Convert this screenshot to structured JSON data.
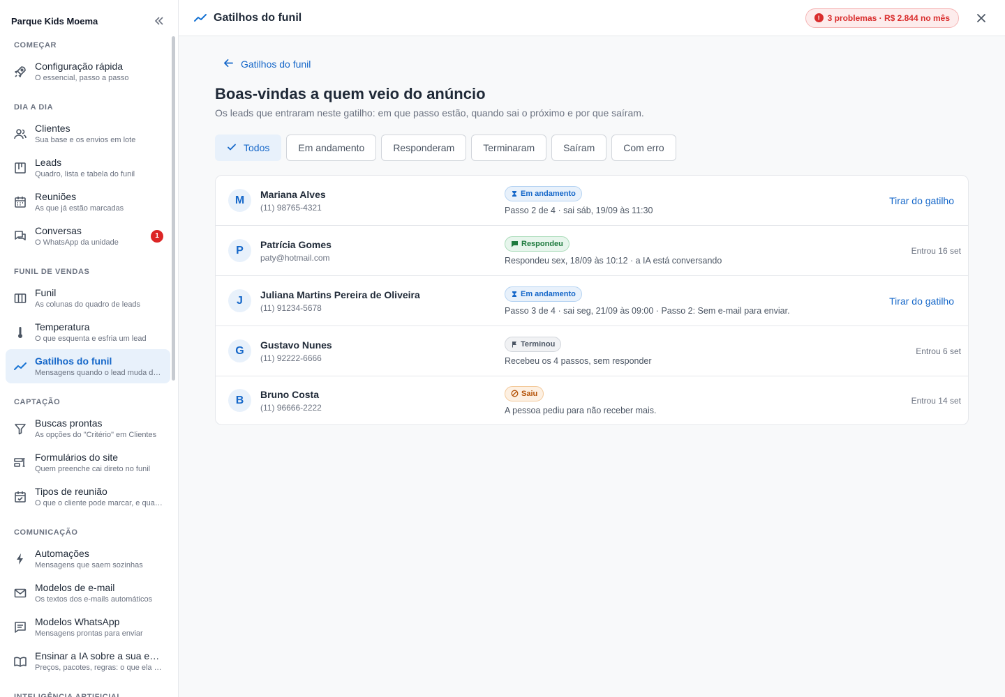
{
  "sidebar": {
    "org_name": "Parque Kids Moema",
    "sections": [
      {
        "label": "COMEÇAR",
        "items": [
          {
            "id": "config",
            "icon": "rocket-icon",
            "label": "Configuração rápida",
            "sub": "O essencial, passo a passo"
          }
        ]
      },
      {
        "label": "DIA A DIA",
        "items": [
          {
            "id": "clientes",
            "icon": "people-icon",
            "label": "Clientes",
            "sub": "Sua base e os envios em lote"
          },
          {
            "id": "leads",
            "icon": "board-icon",
            "label": "Leads",
            "sub": "Quadro, lista e tabela do funil"
          },
          {
            "id": "reunioes",
            "icon": "calendar-icon",
            "label": "Reuniões",
            "sub": "As que já estão marcadas"
          },
          {
            "id": "conversas",
            "icon": "chat-icon",
            "label": "Conversas",
            "sub": "O WhatsApp da unidade",
            "badge": "1"
          }
        ]
      },
      {
        "label": "FUNIL DE VENDAS",
        "items": [
          {
            "id": "funil",
            "icon": "columns-icon",
            "label": "Funil",
            "sub": "As colunas do quadro de leads"
          },
          {
            "id": "temperatura",
            "icon": "thermometer-icon",
            "label": "Temperatura",
            "sub": "O que esquenta e esfria um lead"
          },
          {
            "id": "gatilhos",
            "icon": "trend-icon",
            "label": "Gatilhos do funil",
            "sub": "Mensagens quando o lead muda de etapa",
            "active": true
          }
        ]
      },
      {
        "label": "CAPTAÇÃO",
        "items": [
          {
            "id": "buscas",
            "icon": "filter-icon",
            "label": "Buscas prontas",
            "sub": "As opções do \"Critério\" em Clientes"
          },
          {
            "id": "formularios",
            "icon": "form-icon",
            "label": "Formulários do site",
            "sub": "Quem preenche cai direto no funil"
          },
          {
            "id": "tipos",
            "icon": "calendar-check-icon",
            "label": "Tipos de reunião",
            "sub": "O que o cliente pode marcar, e quando"
          }
        ]
      },
      {
        "label": "COMUNICAÇÃO",
        "items": [
          {
            "id": "automacoes",
            "icon": "bolt-icon",
            "label": "Automações",
            "sub": "Mensagens que saem sozinhas"
          },
          {
            "id": "email",
            "icon": "mail-icon",
            "label": "Modelos de e-mail",
            "sub": "Os textos dos e-mails automáticos"
          },
          {
            "id": "whatsapp",
            "icon": "message-icon",
            "label": "Modelos WhatsApp",
            "sub": "Mensagens prontas para enviar"
          },
          {
            "id": "ia",
            "icon": "book-icon",
            "label": "Ensinar a IA sobre a sua empresa",
            "sub": "Preços, pacotes, regras: o que ela precisa saber"
          }
        ]
      },
      {
        "label": "INTELIGÊNCIA ARTIFICIAL",
        "items": []
      }
    ]
  },
  "topbar": {
    "title": "Gatilhos do funil",
    "problems": "3 problemas · R$ 2.844 no mês"
  },
  "page": {
    "back_label": "Gatilhos do funil",
    "title": "Boas-vindas a quem veio do anúncio",
    "subtitle": "Os leads que entraram neste gatilho: em que passo estão, quando sai o próximo e por que saíram."
  },
  "filters": [
    {
      "label": "Todos",
      "selected": true
    },
    {
      "label": "Em andamento"
    },
    {
      "label": "Responderam"
    },
    {
      "label": "Terminaram"
    },
    {
      "label": "Saíram"
    },
    {
      "label": "Com erro"
    }
  ],
  "rows": [
    {
      "initial": "M",
      "name": "Mariana Alves",
      "contact": "(11) 98765-4321",
      "status": "Em andamento",
      "status_kind": "progress",
      "detail": "Passo 2 de 4 · sai sáb, 19/09 às 11:30",
      "action": "Tirar do gatilho"
    },
    {
      "initial": "P",
      "name": "Patrícia Gomes",
      "contact": "paty@hotmail.com",
      "status": "Respondeu",
      "status_kind": "replied",
      "detail": "Respondeu sex, 18/09 às 10:12 · a IA está conversando",
      "entered": "Entrou 16 set"
    },
    {
      "initial": "J",
      "name": "Juliana Martins Pereira de Oliveira",
      "contact": "(11) 91234-5678",
      "status": "Em andamento",
      "status_kind": "progress",
      "detail": "Passo 3 de 4 · sai seg, 21/09 às 09:00 · Passo 2: Sem e-mail para enviar.",
      "action": "Tirar do gatilho"
    },
    {
      "initial": "G",
      "name": "Gustavo Nunes",
      "contact": "(11) 92222-6666",
      "status": "Terminou",
      "status_kind": "finished",
      "detail": "Recebeu os 4 passos, sem responder",
      "entered": "Entrou 6 set"
    },
    {
      "initial": "B",
      "name": "Bruno Costa",
      "contact": "(11) 96666-2222",
      "status": "Saiu",
      "status_kind": "left",
      "detail": "A pessoa pediu para não receber mais.",
      "entered": "Entrou 14 set"
    }
  ],
  "colors": {
    "accent": "#1567c9",
    "danger": "#d92d2d",
    "success": "#1e7a3e",
    "warning": "#b45309"
  }
}
